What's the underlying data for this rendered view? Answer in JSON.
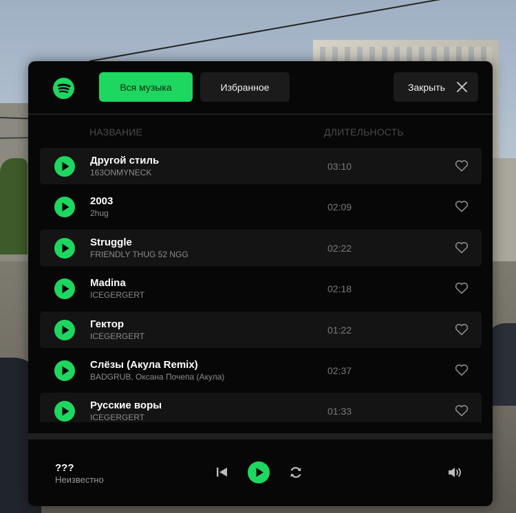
{
  "header": {
    "tab_all": "Вся музыка",
    "tab_favorites": "Избранное",
    "close_label": "Закрыть"
  },
  "columns": {
    "title": "НАЗВАНИЕ",
    "duration": "ДЛИТЕЛЬНОСТЬ"
  },
  "tracks": [
    {
      "title": "Другой стиль",
      "artist": "163ONMYNECK",
      "duration": "03:10"
    },
    {
      "title": "2003",
      "artist": "2hug",
      "duration": "02:09"
    },
    {
      "title": "Struggle",
      "artist": "FRIENDLY THUG 52 NGG",
      "duration": "02:22"
    },
    {
      "title": "Madina",
      "artist": "ICEGERGERT",
      "duration": "02:18"
    },
    {
      "title": "Гектор",
      "artist": "ICEGERGERT",
      "duration": "01:22"
    },
    {
      "title": "Слёзы (Акула Remix)",
      "artist": "BADGRUB, Оксана Почепа (Акула)",
      "duration": "02:37"
    },
    {
      "title": "Русские воры",
      "artist": "ICEGERGERT",
      "duration": "01:33"
    }
  ],
  "now_playing": {
    "title": "???",
    "artist": "Неизвестно"
  },
  "colors": {
    "accent": "#1ed760",
    "panel": "#070707",
    "row_alt": "#141414"
  },
  "icons": {
    "logo": "spotify-logo-icon",
    "close": "close-icon",
    "play": "play-icon",
    "favorite": "heart-outline-icon",
    "previous": "skip-previous-icon",
    "repeat": "repeat-icon",
    "volume": "volume-icon"
  }
}
